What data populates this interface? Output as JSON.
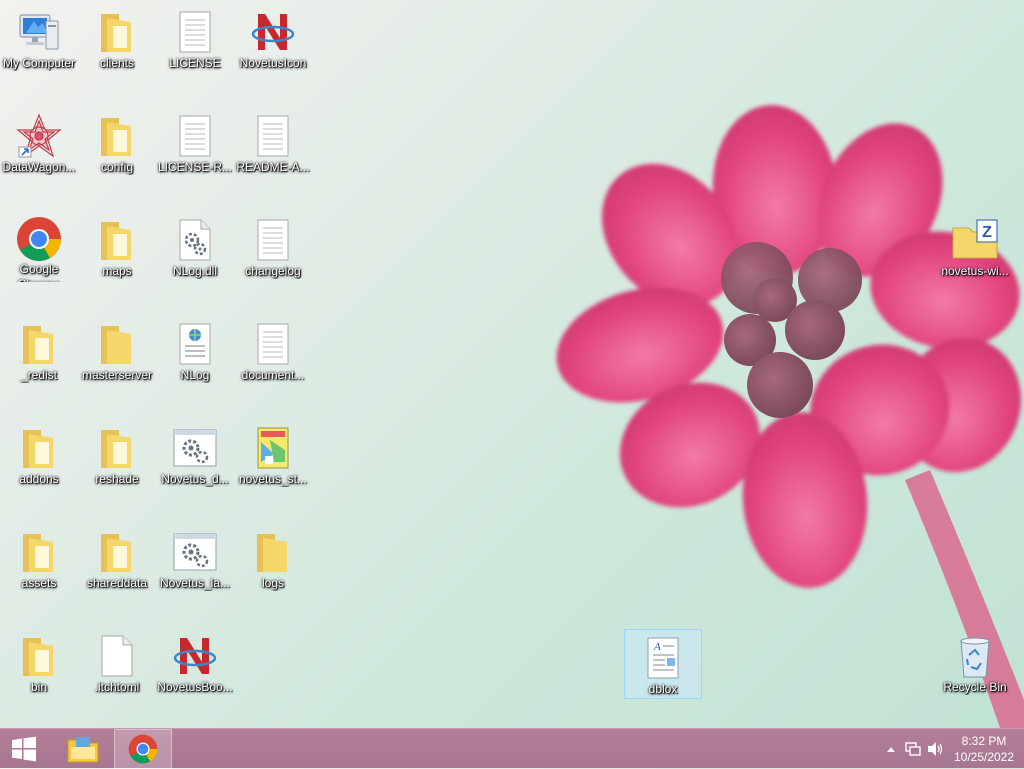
{
  "desktop": {
    "icons": [
      {
        "label": "My Computer"
      },
      {
        "label": "clients"
      },
      {
        "label": "LICENSE"
      },
      {
        "label": "NovetusIcon"
      },
      {
        "label": "DataWagon..."
      },
      {
        "label": "config"
      },
      {
        "label": "LICENSE-R..."
      },
      {
        "label": "README-A..."
      },
      {
        "label": "Google Chrome"
      },
      {
        "label": "maps"
      },
      {
        "label": "NLog.dll"
      },
      {
        "label": "changelog"
      },
      {
        "label": "_redist"
      },
      {
        "label": "masterserver"
      },
      {
        "label": "NLog"
      },
      {
        "label": "document..."
      },
      {
        "label": "addons"
      },
      {
        "label": "reshade"
      },
      {
        "label": "Novetus_d..."
      },
      {
        "label": "novetus_st..."
      },
      {
        "label": "assets"
      },
      {
        "label": "shareddata"
      },
      {
        "label": "Novetus_la..."
      },
      {
        "label": "logs"
      },
      {
        "label": "bin"
      },
      {
        "label": ".itchtoml"
      },
      {
        "label": "NovetusBoo..."
      },
      {
        "label": "novetus-wi..."
      },
      {
        "label": "dblox"
      },
      {
        "label": "Recycle Bin"
      }
    ]
  },
  "taskbar": {
    "clock_time": "8:32 PM",
    "clock_date": "10/25/2022"
  },
  "colors": {
    "taskbar": "#a77690",
    "folder": "#f5d66b",
    "petal": "#e2457e",
    "selection": "#cce8ff"
  }
}
